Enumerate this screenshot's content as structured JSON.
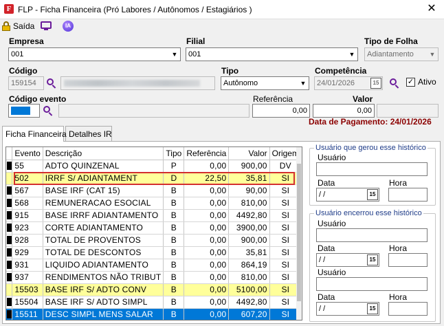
{
  "window": {
    "title": "FLP - Ficha Financeira (Pró Labores / Autônomos / Estagiários )",
    "app_icon": "F",
    "close": "✕"
  },
  "toolbar": {
    "saida_label": "Saída",
    "ia_label": "IA"
  },
  "form": {
    "empresa_label": "Empresa",
    "empresa_value": "001",
    "filial_label": "Filial",
    "filial_value": "001",
    "tipo_folha_label": "Tipo de Folha",
    "tipo_folha_value": "Adiantamento",
    "codigo_label": "Código",
    "codigo_value": "159154",
    "tipo_label": "Tipo",
    "tipo_value": "Autônomo",
    "competencia_label": "Competência",
    "competencia_value": "24/01/2026",
    "ativo_label": "Ativo",
    "ativo_checked": "✓",
    "codigo_evento_label": "Código evento",
    "referencia_label": "Referência",
    "referencia_value": "0,00",
    "valor_label": "Valor",
    "valor_value": "0,00",
    "data_pagamento": "Data de Pagamento: 24/01/2026"
  },
  "tabs": [
    {
      "label": "Ficha Financeira",
      "active": true
    },
    {
      "label": "Detalhes IR",
      "active": false
    }
  ],
  "grid": {
    "columns": [
      "Evento",
      "Descrição",
      "Tipo",
      "Referência",
      "Valor",
      "Origem"
    ],
    "rows": [
      {
        "evento": "55",
        "descricao": "ADTO QUINZENAL",
        "tipo": "P",
        "referencia": "0,00",
        "valor": "900,00",
        "origem": "DV",
        "indicator": true,
        "style": ""
      },
      {
        "evento": "502",
        "descricao": "IRRF S/ ADIANTAMENT",
        "tipo": "D",
        "referencia": "22,50",
        "valor": "35,81",
        "origem": "SI",
        "indicator": false,
        "style": "hl"
      },
      {
        "evento": "567",
        "descricao": "BASE IRF (CAT 15)",
        "tipo": "B",
        "referencia": "0,00",
        "valor": "90,00",
        "origem": "SI",
        "indicator": true,
        "style": ""
      },
      {
        "evento": "568",
        "descricao": "REMUNERACAO ESOCIAL",
        "tipo": "B",
        "referencia": "0,00",
        "valor": "810,00",
        "origem": "SI",
        "indicator": true,
        "style": ""
      },
      {
        "evento": "915",
        "descricao": "BASE IRRF ADIANTAMENTO",
        "tipo": "B",
        "referencia": "0,00",
        "valor": "4492,80",
        "origem": "SI",
        "indicator": true,
        "style": ""
      },
      {
        "evento": "923",
        "descricao": "CORTE ADIANTAMENTO",
        "tipo": "B",
        "referencia": "0,00",
        "valor": "3900,00",
        "origem": "SI",
        "indicator": true,
        "style": ""
      },
      {
        "evento": "928",
        "descricao": "TOTAL DE PROVENTOS",
        "tipo": "B",
        "referencia": "0,00",
        "valor": "900,00",
        "origem": "SI",
        "indicator": true,
        "style": ""
      },
      {
        "evento": "929",
        "descricao": "TOTAL DE DESCONTOS",
        "tipo": "B",
        "referencia": "0,00",
        "valor": "35,81",
        "origem": "SI",
        "indicator": true,
        "style": ""
      },
      {
        "evento": "931",
        "descricao": "LIQUIDO ADIANTAMENTO",
        "tipo": "B",
        "referencia": "0,00",
        "valor": "864,19",
        "origem": "SI",
        "indicator": true,
        "style": ""
      },
      {
        "evento": "937",
        "descricao": "RENDIMENTOS NÃO TRIBUT",
        "tipo": "B",
        "referencia": "0,00",
        "valor": "810,00",
        "origem": "SI",
        "indicator": true,
        "style": ""
      },
      {
        "evento": "15503",
        "descricao": "BASE IRF S/ ADTO CONV",
        "tipo": "B",
        "referencia": "0,00",
        "valor": "5100,00",
        "origem": "SI",
        "indicator": false,
        "style": "hl"
      },
      {
        "evento": "15504",
        "descricao": "BASE IRF S/ ADTO SIMPL",
        "tipo": "B",
        "referencia": "0,00",
        "valor": "4492,80",
        "origem": "SI",
        "indicator": true,
        "style": ""
      },
      {
        "evento": "15511",
        "descricao": "DESC SIMPL MENS SALAR",
        "tipo": "B",
        "referencia": "0,00",
        "valor": "607,20",
        "origem": "SI",
        "indicator": true,
        "style": "sel"
      }
    ]
  },
  "history": {
    "gerou": {
      "title": "Usuário que gerou esse histórico",
      "usuario_label": "Usuário",
      "data_label": "Data",
      "data_value": " / /",
      "hora_label": "Hora"
    },
    "encerrou": {
      "title": "Usuário encerrou esse histórico",
      "usuario_label": "Usuário",
      "data_label": "Data",
      "data_value": " / /",
      "hora_label": "Hora",
      "usuario2_label": "Usuário",
      "data2_label": "Data",
      "data2_value": " / /",
      "hora2_label": "Hora"
    }
  }
}
